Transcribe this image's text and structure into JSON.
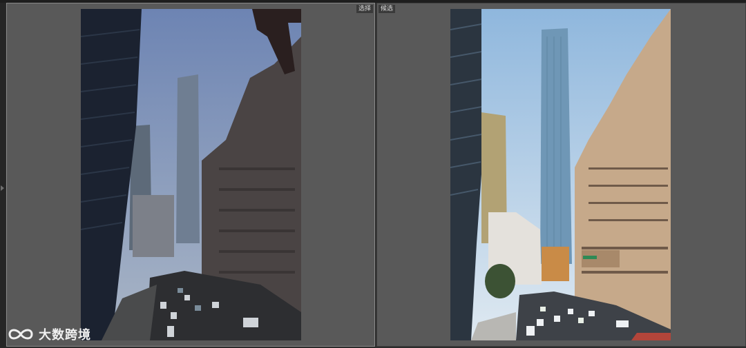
{
  "panels": {
    "select": {
      "label": "选择"
    },
    "candidate": {
      "label": "候选"
    }
  },
  "watermark": {
    "text": "大数跨境",
    "logo": "infinity-logo"
  },
  "icons": {
    "rail": "chevron-right-icon"
  },
  "colors": {
    "background": "#2b2b2b",
    "panel": "#595959",
    "selected_border": "#8a8a8a"
  }
}
